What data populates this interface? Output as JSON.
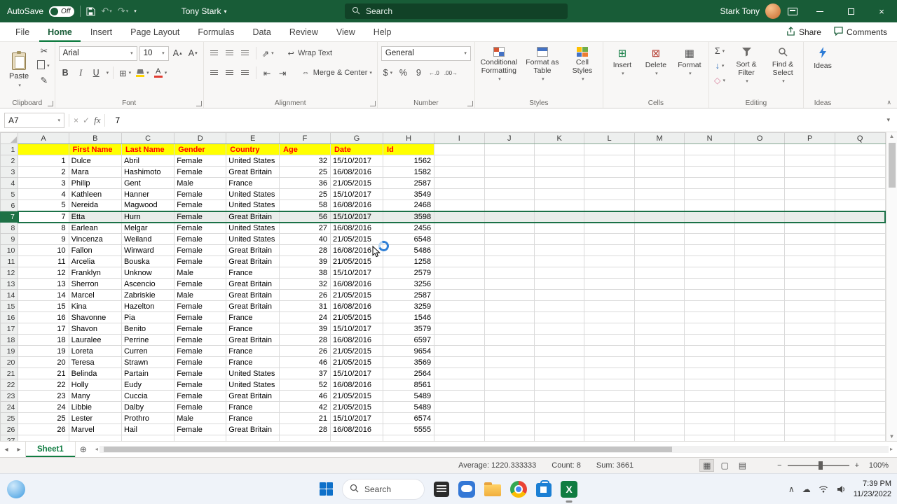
{
  "colors": {
    "titlebar_green": "#185C37",
    "accent_green": "#107C41",
    "header_fill": "#FFFF00",
    "header_text": "#FF0000",
    "selection_border": "#1B7147"
  },
  "titlebar": {
    "autosave": "AutoSave",
    "autosave_state": "Off",
    "user": "Tony Stark",
    "search": "Search",
    "account": "Stark Tony"
  },
  "tabs": {
    "items": [
      "File",
      "Home",
      "Insert",
      "Page Layout",
      "Formulas",
      "Data",
      "Review",
      "View",
      "Help"
    ],
    "active": "Home",
    "share": "Share",
    "comments": "Comments"
  },
  "ribbon": {
    "clipboard": {
      "group": "Clipboard",
      "paste": "Paste"
    },
    "font": {
      "group": "Font",
      "family": "Arial",
      "size": "10"
    },
    "alignment": {
      "group": "Alignment",
      "wrap": "Wrap Text",
      "merge": "Merge & Center"
    },
    "number": {
      "group": "Number",
      "format": "General"
    },
    "styles": {
      "group": "Styles",
      "b1": "Conditional Formatting",
      "b2": "Format as Table",
      "b3": "Cell Styles"
    },
    "cells": {
      "group": "Cells",
      "b1": "Insert",
      "b2": "Delete",
      "b3": "Format"
    },
    "editing": {
      "group": "Editing",
      "b1": "Sort & Filter",
      "b2": "Find & Select"
    },
    "ideas": {
      "group": "Ideas",
      "b1": "Ideas"
    }
  },
  "formula_bar": {
    "name_box": "A7",
    "fx": "fx",
    "value": "7"
  },
  "sheet": {
    "tab_name": "Sheet1",
    "columns": [
      "A",
      "B",
      "C",
      "D",
      "E",
      "F",
      "G",
      "H",
      "I",
      "J",
      "K",
      "L",
      "M",
      "N",
      "O",
      "P",
      "Q"
    ],
    "selected_row": 7,
    "header_row": [
      "First Name",
      "Last Name",
      "Gender",
      "Country",
      "Age",
      "Date",
      "Id"
    ],
    "rows": [
      [
        1,
        "Dulce",
        "Abril",
        "Female",
        "United States",
        32,
        "15/10/2017",
        1562
      ],
      [
        2,
        "Mara",
        "Hashimoto",
        "Female",
        "Great Britain",
        25,
        "16/08/2016",
        1582
      ],
      [
        3,
        "Philip",
        "Gent",
        "Male",
        "France",
        36,
        "21/05/2015",
        2587
      ],
      [
        4,
        "Kathleen",
        "Hanner",
        "Female",
        "United States",
        25,
        "15/10/2017",
        3549
      ],
      [
        5,
        "Nereida",
        "Magwood",
        "Female",
        "United States",
        58,
        "16/08/2016",
        2468
      ],
      [
        7,
        "Etta",
        "Hurn",
        "Female",
        "Great Britain",
        56,
        "15/10/2017",
        3598
      ],
      [
        8,
        "Earlean",
        "Melgar",
        "Female",
        "United States",
        27,
        "16/08/2016",
        2456
      ],
      [
        9,
        "Vincenza",
        "Weiland",
        "Female",
        "United States",
        40,
        "21/05/2015",
        6548
      ],
      [
        10,
        "Fallon",
        "Winward",
        "Female",
        "Great Britain",
        28,
        "16/08/2016",
        5486
      ],
      [
        11,
        "Arcelia",
        "Bouska",
        "Female",
        "Great Britain",
        39,
        "21/05/2015",
        1258
      ],
      [
        12,
        "Franklyn",
        "Unknow",
        "Male",
        "France",
        38,
        "15/10/2017",
        2579
      ],
      [
        13,
        "Sherron",
        "Ascencio",
        "Female",
        "Great Britain",
        32,
        "16/08/2016",
        3256
      ],
      [
        14,
        "Marcel",
        "Zabriskie",
        "Male",
        "Great Britain",
        26,
        "21/05/2015",
        2587
      ],
      [
        15,
        "Kina",
        "Hazelton",
        "Female",
        "Great Britain",
        31,
        "16/08/2016",
        3259
      ],
      [
        16,
        "Shavonne",
        "Pia",
        "Female",
        "France",
        24,
        "21/05/2015",
        1546
      ],
      [
        17,
        "Shavon",
        "Benito",
        "Female",
        "France",
        39,
        "15/10/2017",
        3579
      ],
      [
        18,
        "Lauralee",
        "Perrine",
        "Female",
        "Great Britain",
        28,
        "16/08/2016",
        6597
      ],
      [
        19,
        "Loreta",
        "Curren",
        "Female",
        "France",
        26,
        "21/05/2015",
        9654
      ],
      [
        20,
        "Teresa",
        "Strawn",
        "Female",
        "France",
        46,
        "21/05/2015",
        3569
      ],
      [
        21,
        "Belinda",
        "Partain",
        "Female",
        "United States",
        37,
        "15/10/2017",
        2564
      ],
      [
        22,
        "Holly",
        "Eudy",
        "Female",
        "United States",
        52,
        "16/08/2016",
        8561
      ],
      [
        23,
        "Many",
        "Cuccia",
        "Female",
        "Great Britain",
        46,
        "21/05/2015",
        5489
      ],
      [
        24,
        "Libbie",
        "Dalby",
        "Female",
        "France",
        42,
        "21/05/2015",
        5489
      ],
      [
        25,
        "Lester",
        "Prothro",
        "Male",
        "France",
        21,
        "15/10/2017",
        6574
      ],
      [
        26,
        "Marvel",
        "Hail",
        "Female",
        "Great Britain",
        28,
        "16/08/2016",
        5555
      ]
    ]
  },
  "status_bar": {
    "average": "Average: 1220.333333",
    "count": "Count: 8",
    "sum": "Sum: 3661",
    "zoom": "100%"
  },
  "taskbar": {
    "search": "Search",
    "time": "7:39 PM",
    "date": "11/23/2022"
  },
  "icons": {
    "dropdown": "▾",
    "undo": "↶",
    "redo": "↷",
    "cut": "✂",
    "format_painter": "✎",
    "bold": "B",
    "italic": "I",
    "underline": "U",
    "font_letter": "A",
    "up_small": "▴",
    "down_small": "▾",
    "borders": "⊞",
    "orientation": "⇗",
    "indent_decrease": "⇤",
    "indent_increase": "⇥",
    "wrap": "↩",
    "merge": "⇔",
    "currency": "$",
    "percent": "%",
    "comma": "9",
    "increase_decimal": "←.0",
    "decrease_decimal": ".00→",
    "autosum": "Σ",
    "fill": "↓",
    "clear": "◇",
    "insert_cells": "⊞",
    "delete_cells": "⊠",
    "format_cells": "▦",
    "close": "×",
    "chevron_up": "∧",
    "cloud": "☁",
    "view_normal": "▦",
    "view_page": "▢",
    "view_break": "▤",
    "zoom_out": "−",
    "zoom_in": "+",
    "nav_left": "◂",
    "nav_right": "▸",
    "add_sheet": "⊕",
    "cancel": "×",
    "enter": "✓",
    "excel_logo": "X"
  }
}
